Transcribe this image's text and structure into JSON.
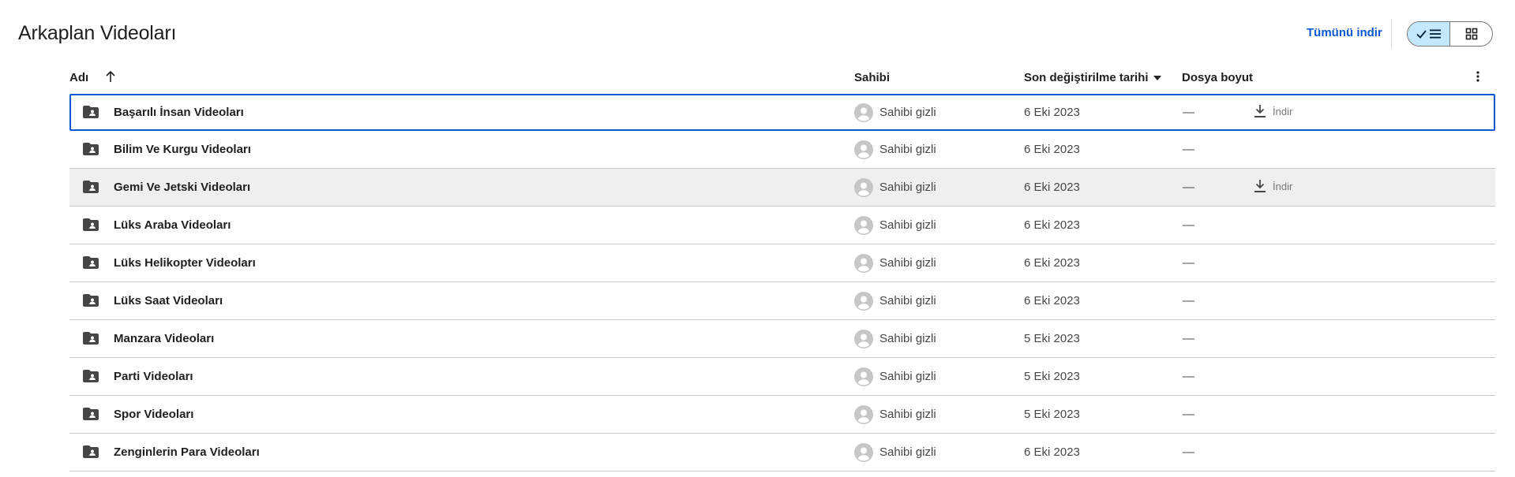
{
  "page": {
    "title": "Arkaplan Videoları",
    "download_all": "Tümünü indir"
  },
  "view_toggle": {
    "active": "list",
    "list_icon": "check-list-icon",
    "grid_icon": "grid-icon"
  },
  "table": {
    "headers": {
      "name": "Adı",
      "owner": "Sahibi",
      "modified": "Son değiştirilme tarihi",
      "size": "Dosya boyut"
    },
    "sort": {
      "column": "name",
      "direction": "ascending",
      "icon": "arrow-up-icon"
    },
    "download_label": "İndir",
    "rows": [
      {
        "name": "Başarılı İnsan Videoları",
        "owner": "Sahibi gizli",
        "date": "6 Eki 2023",
        "size": "—"
      },
      {
        "name": "Bilim Ve Kurgu Videoları",
        "owner": "Sahibi gizli",
        "date": "6 Eki 2023",
        "size": "—"
      },
      {
        "name": "Gemi Ve Jetski Videoları",
        "owner": "Sahibi gizli",
        "date": "6 Eki 2023",
        "size": "—"
      },
      {
        "name": "Lüks Araba Videoları",
        "owner": "Sahibi gizli",
        "date": "6 Eki 2023",
        "size": "—"
      },
      {
        "name": "Lüks Helikopter Videoları",
        "owner": "Sahibi gizli",
        "date": "6 Eki 2023",
        "size": "—"
      },
      {
        "name": "Lüks Saat Videoları",
        "owner": "Sahibi gizli",
        "date": "6 Eki 2023",
        "size": "—"
      },
      {
        "name": "Manzara Videoları",
        "owner": "Sahibi gizli",
        "date": "5 Eki 2023",
        "size": "—"
      },
      {
        "name": "Parti Videoları",
        "owner": "Sahibi gizli",
        "date": "5 Eki 2023",
        "size": "—"
      },
      {
        "name": "Spor Videoları",
        "owner": "Sahibi gizli",
        "date": "5 Eki 2023",
        "size": "—"
      },
      {
        "name": "Zenginlerin Para Videoları",
        "owner": "Sahibi gizli",
        "date": "6 Eki 2023",
        "size": "—"
      }
    ]
  },
  "colors": {
    "accent": "#0b57d0",
    "toggle_active": "#c2e7ff",
    "row_hover": "#eef0f0"
  }
}
